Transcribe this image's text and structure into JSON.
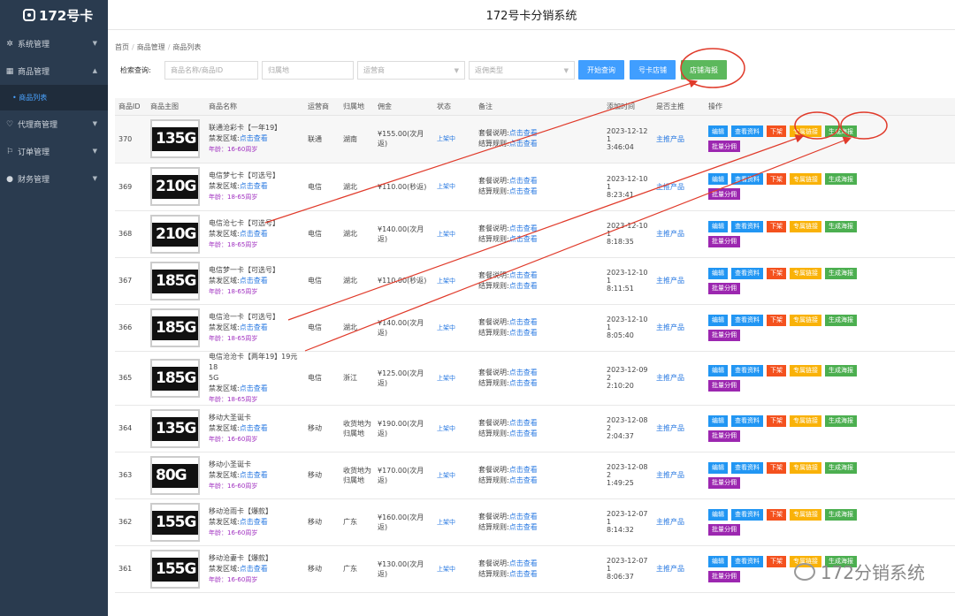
{
  "app": {
    "logo_text": "172号卡",
    "title": "172号卡分销系统"
  },
  "sidebar": {
    "items": [
      {
        "label": "系统管理",
        "icon": "gear-icon"
      },
      {
        "label": "商品管理",
        "icon": "cart-icon",
        "sub": "商品列表"
      },
      {
        "label": "代理商管理",
        "icon": "agent-icon"
      },
      {
        "label": "订单管理",
        "icon": "order-icon"
      },
      {
        "label": "财务管理",
        "icon": "finance-icon"
      }
    ]
  },
  "breadcrumb": [
    "首页",
    "商品管理",
    "商品列表"
  ],
  "search": {
    "label": "检索查询:",
    "name_placeholder": "商品名称/商品ID",
    "region_placeholder": "归属地",
    "carrier_placeholder": "运营商",
    "type_placeholder": "返佣类型",
    "btn_search": "开始查询",
    "btn_store": "号卡店铺",
    "btn_poster": "店铺海报"
  },
  "table": {
    "headers": [
      "商品ID",
      "商品主图",
      "商品名称",
      "运营商",
      "归属地",
      "佣金",
      "状态",
      "备注",
      "添加时间",
      "是否主推",
      "操作"
    ],
    "ops": {
      "edit": "编辑",
      "view": "查看资料",
      "down": "下架",
      "link": "专属链接",
      "poster": "生成海报",
      "batch": "批量分佣"
    },
    "labels": {
      "ban": "禁发区域:",
      "ban_link": "点击查看",
      "pkg": "套餐说明:",
      "settle": "结算规则:",
      "status": "上架中",
      "promote": "主推产品"
    },
    "rows": [
      {
        "id": "370",
        "img": "135G",
        "name": "联通沧彩卡【一年19】",
        "age": "年龄：16-60周岁",
        "carrier": "联通",
        "region": "湖南",
        "commission": "¥155.00(次月返)",
        "time1": "2023-12-12 1",
        "time2": "3:46:04"
      },
      {
        "id": "369",
        "img": "210G",
        "name": "电信梦七卡【可选号】",
        "age": "年龄：18-65周岁",
        "carrier": "电信",
        "region": "湖北",
        "commission": "¥110.00(秒返)",
        "time1": "2023-12-10 1",
        "time2": "8:23:41"
      },
      {
        "id": "368",
        "img": "210G",
        "name": "电信沧七卡【可选号】",
        "age": "年龄：18-65周岁",
        "carrier": "电信",
        "region": "湖北",
        "commission": "¥140.00(次月返)",
        "time1": "2023-12-10 1",
        "time2": "8:18:35"
      },
      {
        "id": "367",
        "img": "185G",
        "name": "电信梦一卡【可选号】",
        "age": "年龄：18-65周岁",
        "carrier": "电信",
        "region": "湖北",
        "commission": "¥110.00(秒返)",
        "time1": "2023-12-10 1",
        "time2": "8:11:51"
      },
      {
        "id": "366",
        "img": "185G",
        "name": "电信沧一卡【可选号】",
        "age": "年龄：18-65周岁",
        "carrier": "电信",
        "region": "湖北",
        "commission": "¥140.00(次月返)",
        "time1": "2023-12-10 1",
        "time2": "8:05:40"
      },
      {
        "id": "365",
        "img": "185G",
        "name": "电信沧沧卡【两年19】19元18",
        "name2": "5G",
        "age": "年龄：18-65周岁",
        "carrier": "电信",
        "region": "浙江",
        "commission": "¥125.00(次月返)",
        "time1": "2023-12-09 2",
        "time2": "2:10:20"
      },
      {
        "id": "364",
        "img": "135G",
        "name": "移动大圣诞卡",
        "age": "年龄：16-60周岁",
        "carrier": "移动",
        "region": "收货地为",
        "region2": "归属地",
        "commission": "¥190.00(次月返)",
        "time1": "2023-12-08 2",
        "time2": "2:04:37"
      },
      {
        "id": "363",
        "img": "80G",
        "name": "移动小圣诞卡",
        "age": "年龄：16-60周岁",
        "carrier": "移动",
        "region": "收货地为",
        "region2": "归属地",
        "commission": "¥170.00(次月返)",
        "time1": "2023-12-08 2",
        "time2": "1:49:25"
      },
      {
        "id": "362",
        "img": "155G",
        "name": "移动沧雨卡【爆款】",
        "age": "年龄：16-60周岁",
        "carrier": "移动",
        "region": "广东",
        "commission": "¥160.00(次月返)",
        "time1": "2023-12-07 1",
        "time2": "8:14:32"
      },
      {
        "id": "361",
        "img": "155G",
        "name": "移动沧妻卡【爆款】",
        "age": "年龄：16-60周岁",
        "carrier": "移动",
        "region": "广东",
        "commission": "¥130.00(次月返)",
        "time1": "2023-12-07 1",
        "time2": "8:06:37"
      }
    ]
  },
  "watermark": "172分销系统",
  "colors": {
    "sidebar": "#2a3b4f",
    "accent": "#409eff",
    "annotation": "#e03a2a"
  }
}
